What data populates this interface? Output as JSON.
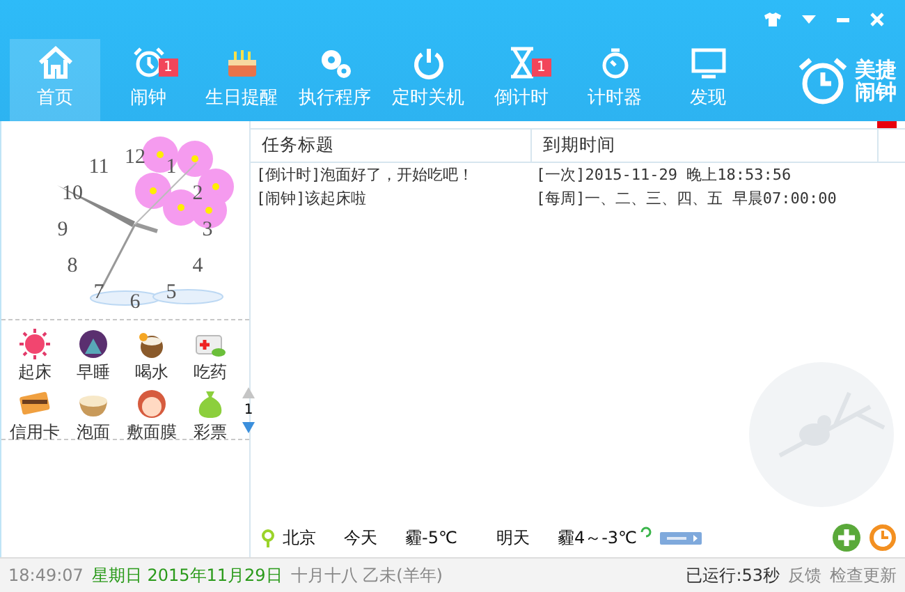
{
  "nav": [
    {
      "label": "首页",
      "selected": true
    },
    {
      "label": "闹钟",
      "selected": false,
      "badge": "1"
    },
    {
      "label": "生日提醒",
      "selected": false
    },
    {
      "label": "执行程序",
      "selected": false
    },
    {
      "label": "定时关机",
      "selected": false
    },
    {
      "label": "倒计时",
      "selected": false,
      "badge": "1"
    },
    {
      "label": "计时器",
      "selected": false
    },
    {
      "label": "发现",
      "selected": false
    }
  ],
  "logo": {
    "line1": "美捷",
    "line2": "闹钟"
  },
  "clock": {
    "numerals": [
      "12",
      "1",
      "2",
      "3",
      "4",
      "5",
      "6",
      "7",
      "8",
      "9",
      "10",
      "11"
    ]
  },
  "quick_items": [
    {
      "label": "起床"
    },
    {
      "label": "早睡"
    },
    {
      "label": "喝水"
    },
    {
      "label": "吃药"
    },
    {
      "label": "信用卡"
    },
    {
      "label": "泡面"
    },
    {
      "label": "敷面膜"
    },
    {
      "label": "彩票"
    }
  ],
  "quick_page": "1",
  "table": {
    "columns": [
      "任务标题",
      "到期时间"
    ],
    "rows": [
      [
        "[倒计时]泡面好了，开始吃吧！",
        "[一次]2015-11-29 晚上18:53:56"
      ],
      [
        "[闹钟]该起床啦",
        "[每周]一、二、三、四、五 早晨07:00:00"
      ]
    ]
  },
  "weather": {
    "city": "北京",
    "today_label": "今天",
    "today": "霾-5℃",
    "tomorrow_label": "明天",
    "tomorrow": "霾4～-3℃"
  },
  "status_bar": {
    "time": "18:49:07",
    "date": "星期日 2015年11月29日",
    "lunar": "十月十八 乙未(羊年)",
    "uptime": "已运行:53秒",
    "feedback": "反馈",
    "update": "检查更新"
  }
}
